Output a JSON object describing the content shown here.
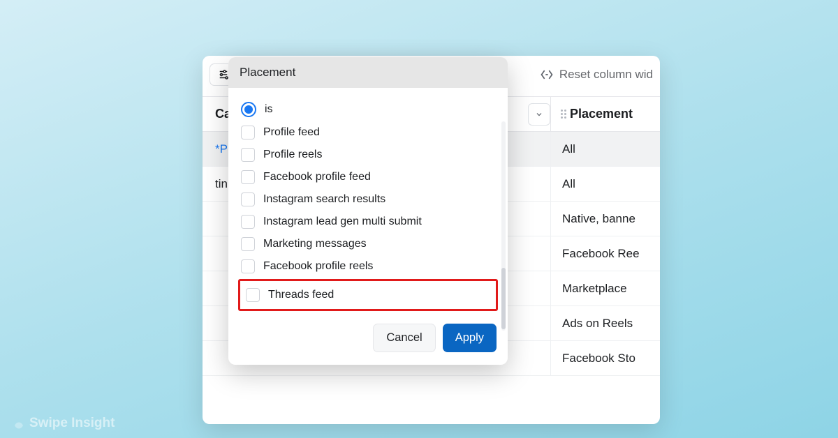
{
  "brand": {
    "watermark": "Swipe Insight"
  },
  "toolbar": {
    "filter_label": "Placement",
    "reset_label": "Reset column wid"
  },
  "columns": {
    "campaign_header": "Ca",
    "placement_header": "Placement"
  },
  "rows": [
    {
      "left": "*P",
      "right": "All",
      "promo": true
    },
    {
      "left": "tin…",
      "right": "All",
      "link": true
    },
    {
      "left": "",
      "right": "Native, banne"
    },
    {
      "left": "",
      "right": "Facebook Ree"
    },
    {
      "left": "",
      "right": "Marketplace"
    },
    {
      "left": "",
      "right": "Ads on Reels"
    },
    {
      "left": "",
      "right": "Facebook Sto"
    }
  ],
  "popover": {
    "title": "Placement",
    "radio_label": "is",
    "options": [
      "Profile feed",
      "Profile reels",
      "Facebook profile feed",
      "Instagram search results",
      "Instagram lead gen multi submit",
      "Marketing messages",
      "Facebook profile reels"
    ],
    "highlighted_option": "Threads feed",
    "cancel_label": "Cancel",
    "apply_label": "Apply"
  }
}
